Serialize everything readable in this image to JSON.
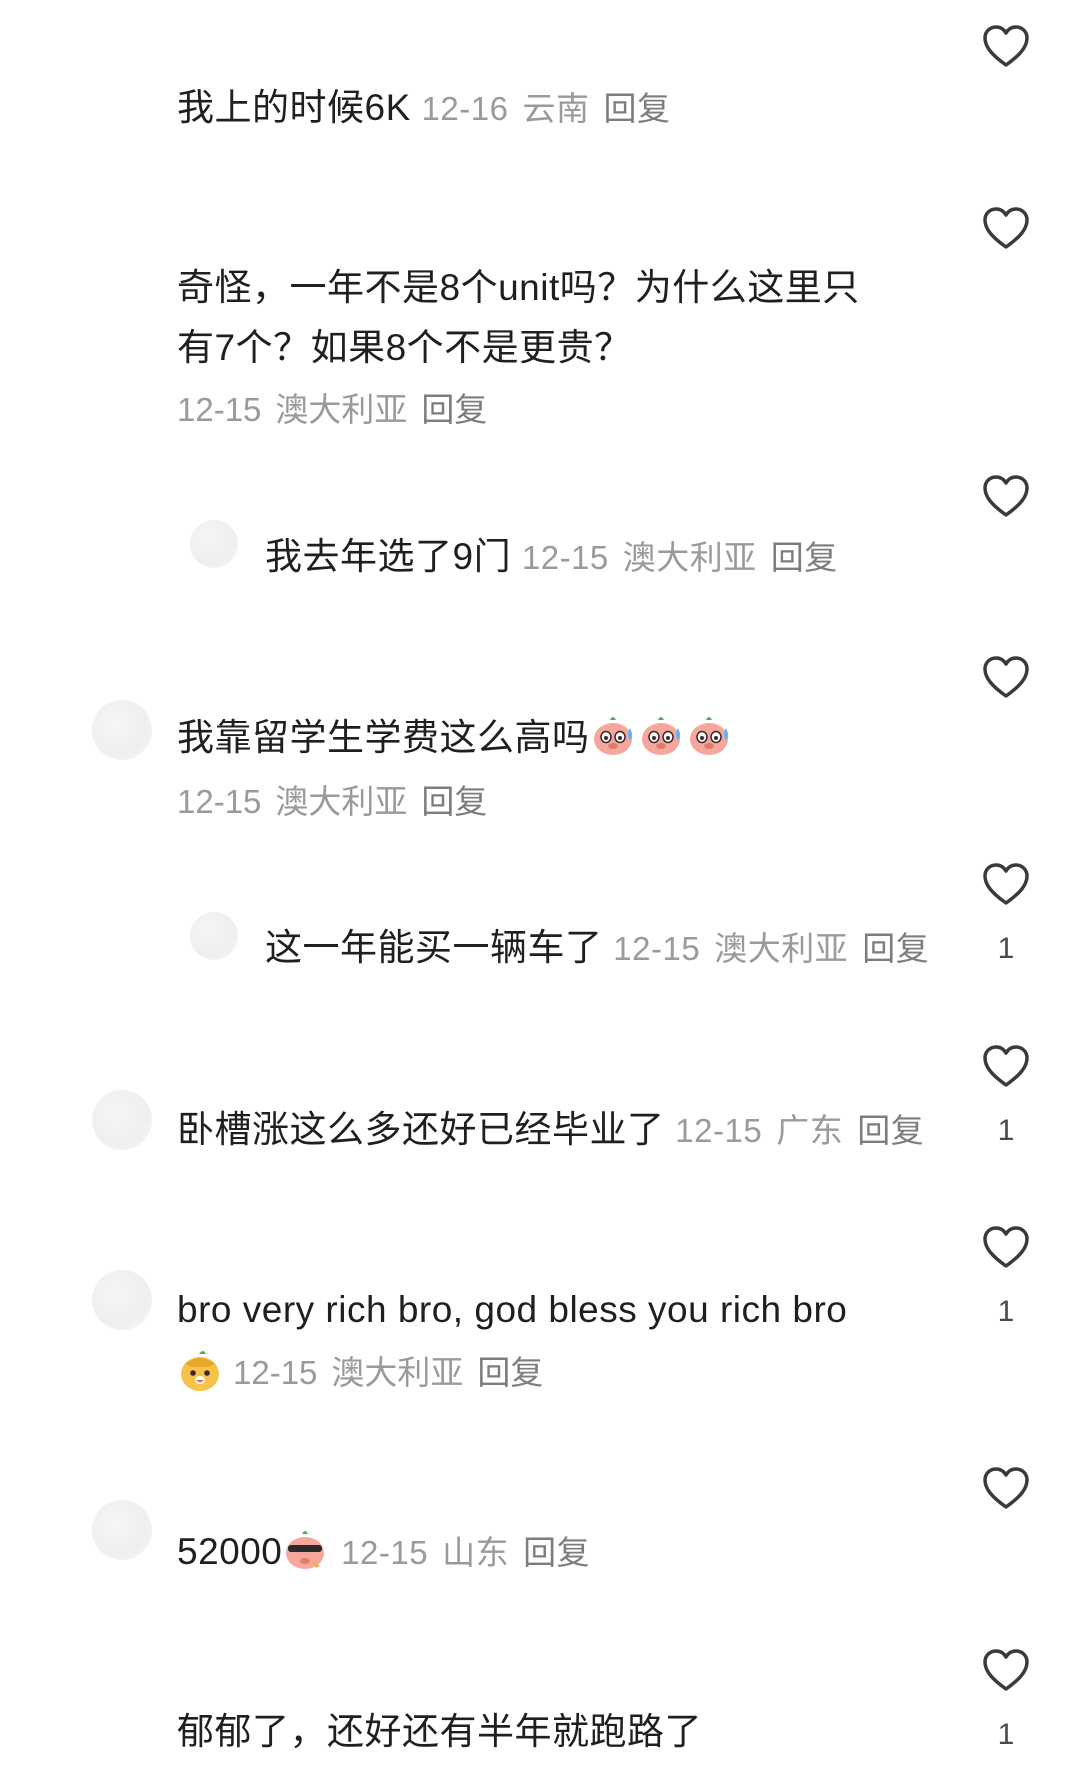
{
  "comments": [
    {
      "text": "我上的时候6K",
      "date": "12-16",
      "location": "云南",
      "reply": "回复",
      "likes": ""
    },
    {
      "text_line1": "奇怪，一年不是8个unit吗？为什么这里只",
      "text_line2": "有7个？如果8个不是更贵？",
      "date": "12-15",
      "location": "澳大利亚",
      "reply": "回复",
      "likes": ""
    },
    {
      "text": "我去年选了9门",
      "date": "12-15",
      "location": "澳大利亚",
      "reply": "回复",
      "likes": ""
    },
    {
      "text": "我靠留学生学费这么高吗",
      "emoji": "sweating-pig-emoji",
      "date": "12-15",
      "location": "澳大利亚",
      "reply": "回复",
      "likes": ""
    },
    {
      "text": "这一年能买一辆车了",
      "date": "12-15",
      "location": "澳大利亚",
      "reply": "回复",
      "likes": "1"
    },
    {
      "text": "卧槽涨这么多还好已经毕业了",
      "date": "12-15",
      "location": "广东",
      "reply": "回复",
      "likes": "1"
    },
    {
      "text": "bro very rich bro, god bless you rich bro",
      "emoji": "happy-face-emoji",
      "date": "12-15",
      "location": "澳大利亚",
      "reply": "回复",
      "likes": "1"
    },
    {
      "text": "52000",
      "emoji": "cool-pig-emoji",
      "date": "12-15",
      "location": "山东",
      "reply": "回复",
      "likes": ""
    },
    {
      "text": "郁郁了，还好还有半年就跑路了",
      "likes": "1"
    }
  ],
  "icons": {
    "like": "heart-outline-icon"
  },
  "colors": {
    "text": "#1f1f1f",
    "meta": "#9a9a9a",
    "heart": "#3a3a3a"
  }
}
